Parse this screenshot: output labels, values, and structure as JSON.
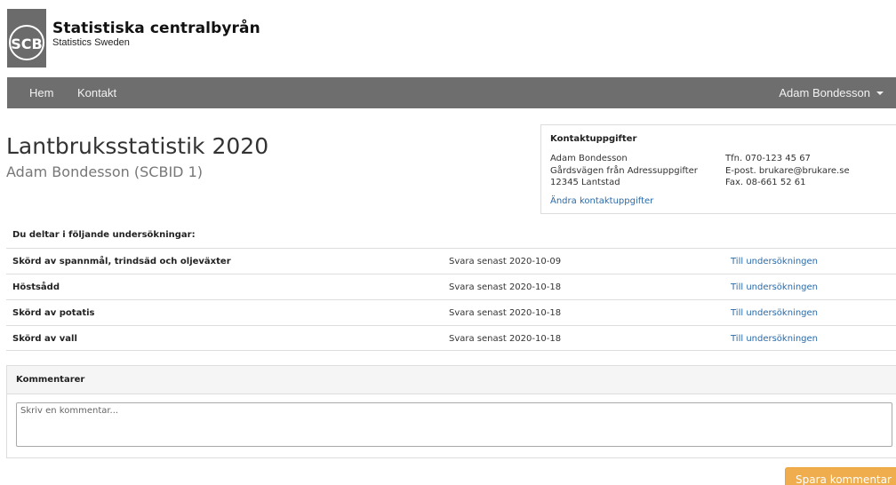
{
  "brand": {
    "logo_text": "SCB",
    "title": "Statistiska centralbyrån",
    "subtitle": "Statistics Sweden"
  },
  "nav": {
    "home": "Hem",
    "contact": "Kontakt",
    "user": "Adam Bondesson"
  },
  "page": {
    "title": "Lantbruksstatistik 2020",
    "subtitle": "Adam Bondesson (SCBID 1)"
  },
  "contact": {
    "heading": "Kontaktuppgifter",
    "name": "Adam Bondesson",
    "street": "Gårdsvägen från Adressuppgifter",
    "postal": "12345 Lantstad",
    "phone": "Tfn. 070-123 45 67",
    "email": "E-post. brukare@brukare.se",
    "fax": "Fax. 08-661 52 61",
    "edit_link": "Ändra kontaktuppgifter"
  },
  "surveys": {
    "heading": "Du deltar i följande undersökningar:",
    "rows": [
      {
        "name": "Skörd av spannmål, trindsäd och oljeväxter",
        "deadline": "Svara senast 2020-10-09",
        "link": "Till undersökningen"
      },
      {
        "name": "Höstsådd",
        "deadline": "Svara senast 2020-10-18",
        "link": "Till undersökningen"
      },
      {
        "name": "Skörd av potatis",
        "deadline": "Svara senast 2020-10-18",
        "link": "Till undersökningen"
      },
      {
        "name": "Skörd av vall",
        "deadline": "Svara senast 2020-10-18",
        "link": "Till undersökningen"
      }
    ]
  },
  "comments": {
    "heading": "Kommentarer",
    "placeholder": "Skriv en kommentar...",
    "value": "",
    "save_label": "Spara kommentar"
  },
  "colors": {
    "navbar": "#6e6e6e",
    "link": "#2a6aa8",
    "save_button": "#f0ad4e",
    "logo_bg": "#6b6b6b"
  }
}
